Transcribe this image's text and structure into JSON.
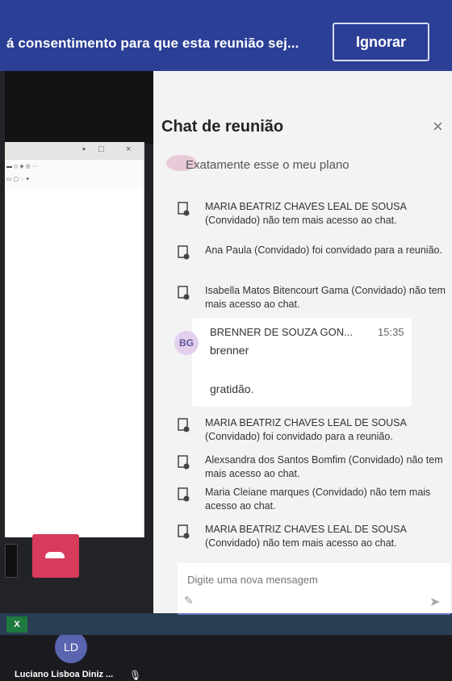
{
  "banner": {
    "text": "á consentimento para que esta reunião sej...",
    "dismiss_label": "Ignorar"
  },
  "chat": {
    "title": "Chat de reunião",
    "close_icon": "close-icon",
    "partial_message": "Exatamente esse o meu plano",
    "system_messages_top": [
      {
        "name": "MARIA BEATRIZ CHAVES LEAL DE SOUSA",
        "text": "(Convidado) não tem mais acesso ao chat."
      },
      {
        "name": "Ana Paula (Convidado)",
        "text": "foi convidado para a reunião."
      },
      {
        "name": "Isabella Matos Bitencourt Gama",
        "text": "(Convidado) não tem mais acesso ao chat."
      }
    ],
    "message": {
      "avatar": "BG",
      "sender": "BRENNER DE SOUZA GON...",
      "time": "15:35",
      "lines": [
        "brenner",
        "gratidão."
      ]
    },
    "system_messages_bottom": [
      {
        "name": "MARIA BEATRIZ CHAVES LEAL DE SOUSA",
        "text": "(Convidado) foi convidado para a reunião."
      },
      {
        "name": "Alexsandra dos Santos Bomfim",
        "text": "(Convidado) não tem mais acesso ao chat."
      },
      {
        "name": "Maria Cleiane marques (Convidado)",
        "text": "não tem mais acesso ao chat."
      },
      {
        "name": "MARIA BEATRIZ CHAVES LEAL DE SOUSA",
        "text": "(Convidado) não tem mais acesso ao chat."
      }
    ],
    "compose_placeholder": "Digite uma nova mensagem"
  },
  "participant": {
    "initials": "LD",
    "name": "Luciano Lisboa Diniz ..."
  },
  "colors": {
    "banner": "#2c3f96",
    "leave_button": "#d73a5a",
    "chat_background": "#f3f3f4",
    "avatar_ld": "#5a64b0"
  }
}
